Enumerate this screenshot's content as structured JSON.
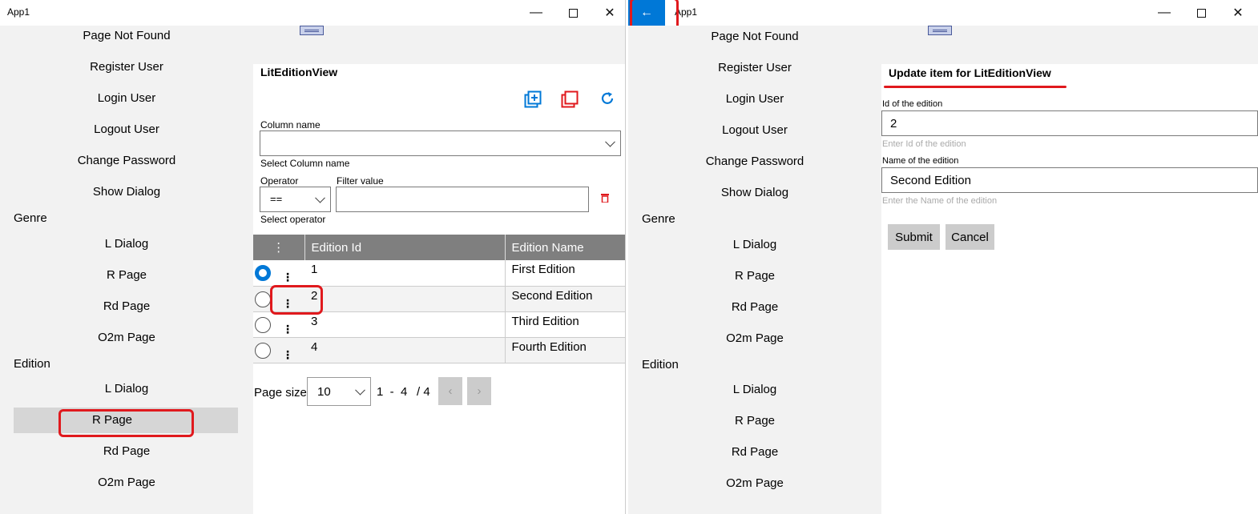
{
  "left": {
    "app_title": "App1",
    "nav_top": [
      "Page Not Found",
      "Register User",
      "Login User",
      "Logout User",
      "Change Password",
      "Show Dialog"
    ],
    "genre_label": "Genre",
    "genre_items": [
      "L Dialog",
      "R Page",
      "Rd Page",
      "O2m Page"
    ],
    "edition_label": "Edition",
    "edition_items": [
      "L Dialog",
      "R Page",
      "Rd Page",
      "O2m Page"
    ],
    "view_title": "LitEditionView",
    "column_name_label": "Column name",
    "column_name_hint": "Select Column name",
    "operator_label": "Operator",
    "operator_value": "==",
    "operator_hint": "Select operator",
    "filter_value_label": "Filter value",
    "grid": {
      "menu_header": "⋮",
      "columns": [
        "Edition Id",
        "Edition Name"
      ],
      "rows": [
        {
          "id": "1",
          "name": "First Edition",
          "selected": true
        },
        {
          "id": "2",
          "name": "Second Edition",
          "selected": false
        },
        {
          "id": "3",
          "name": "Third Edition",
          "selected": false
        },
        {
          "id": "4",
          "name": "Fourth Edition",
          "selected": false
        }
      ]
    },
    "page_size_label": "Page size",
    "page_size_value": "10",
    "page_range": "1  -  4",
    "page_total": "/ 4",
    "prev": "‹",
    "next": "›",
    "accent": "#0078d7",
    "danger": "#e0191d"
  },
  "right": {
    "app_title": "App1",
    "back": "←",
    "nav_top": [
      "Page Not Found",
      "Register User",
      "Login User",
      "Logout User",
      "Change Password",
      "Show Dialog"
    ],
    "genre_label": "Genre",
    "genre_items": [
      "L Dialog",
      "R Page",
      "Rd Page",
      "O2m Page"
    ],
    "edition_label": "Edition",
    "edition_items": [
      "L Dialog",
      "R Page",
      "Rd Page",
      "O2m Page"
    ],
    "form_title": "Update item for LitEditionView",
    "id_label": "Id of the edition",
    "id_value": "2",
    "id_hint": "Enter Id of the edition",
    "name_label": "Name of the edition",
    "name_value": "Second Edition",
    "name_hint": "Enter the Name of the edition",
    "submit": "Submit",
    "cancel": "Cancel"
  }
}
